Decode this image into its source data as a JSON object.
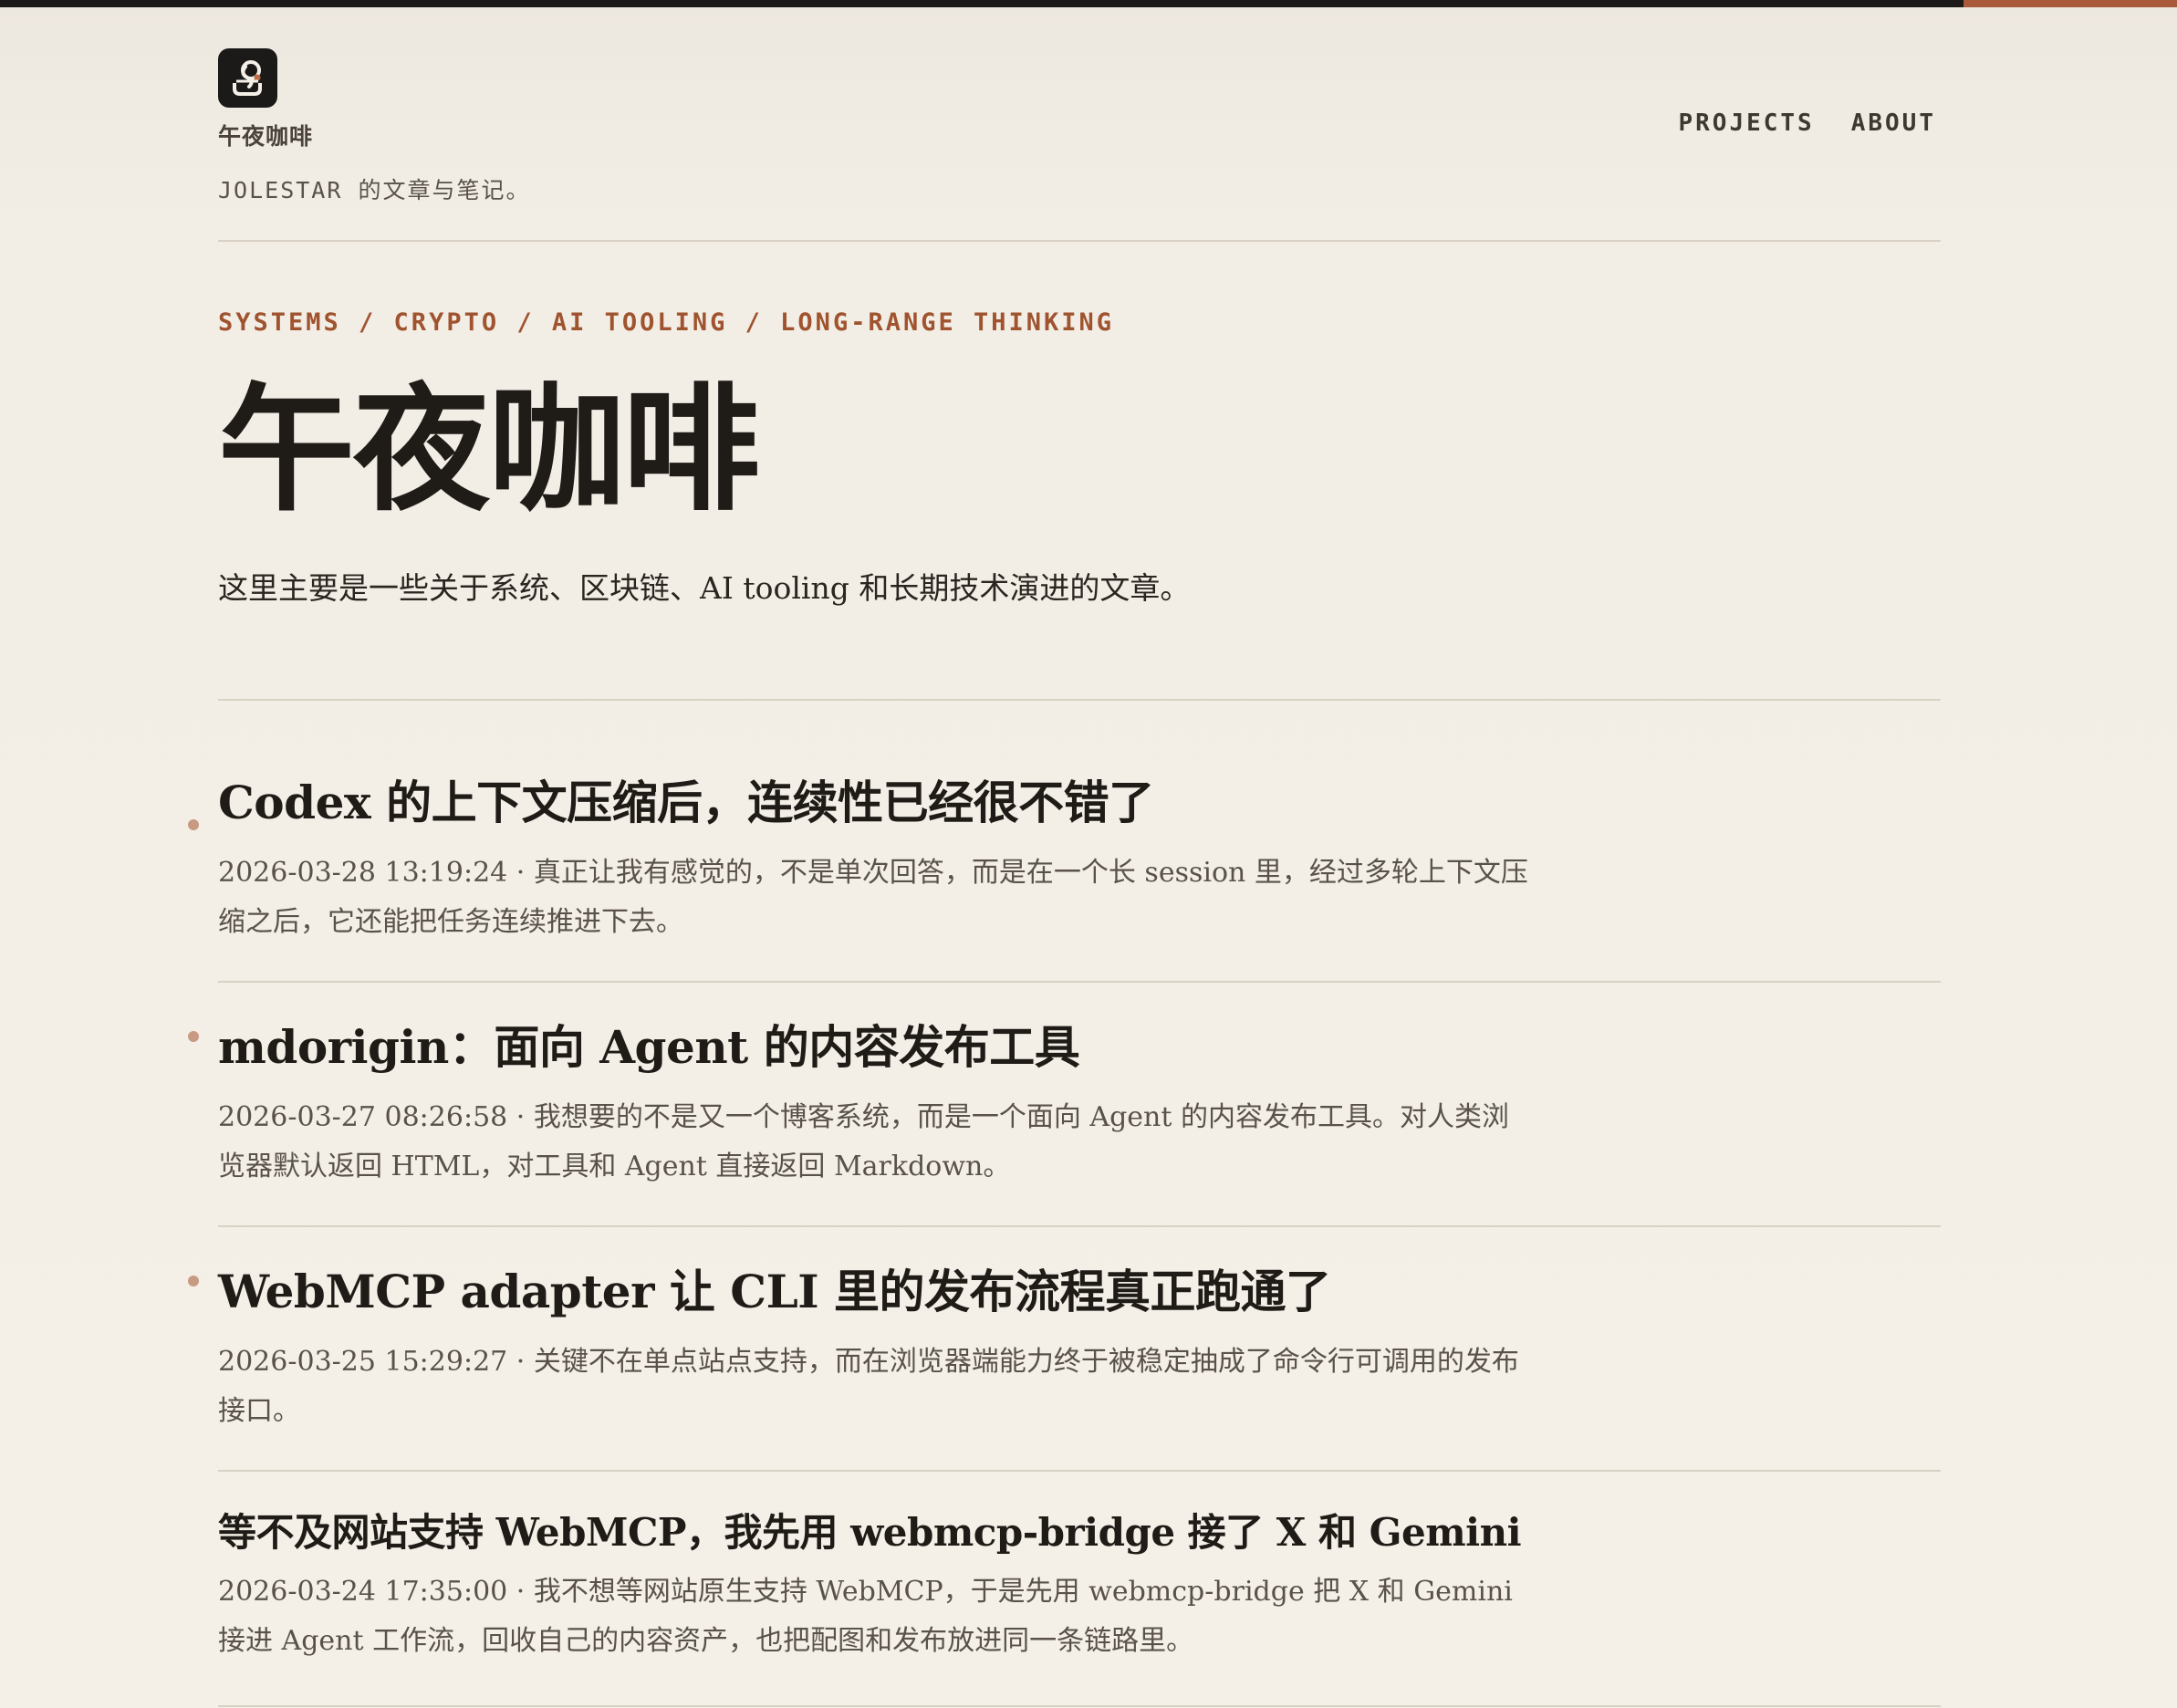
{
  "site": {
    "name": "午夜咖啡",
    "tagline": "JOLESTAR 的文章与笔记。"
  },
  "nav": {
    "items": [
      {
        "label": "PROJECTS"
      },
      {
        "label": "ABOUT"
      }
    ]
  },
  "hero": {
    "kicker": "SYSTEMS / CRYPTO / AI TOOLING / LONG-RANGE THINKING",
    "title": "午夜咖啡",
    "description": "这里主要是一些关于系统、区块链、AI tooling 和长期技术演进的文章。"
  },
  "posts": [
    {
      "title": "Codex 的上下文压缩后，连续性已经很不错了",
      "date": "2026-03-28 13:19:24",
      "separator": "·",
      "summary": "真正让我有感觉的，不是单次回答，而是在一个长 session 里，经过多轮上下文压缩之后，它还能把任务连续推进下去。"
    },
    {
      "title": "mdorigin：面向 Agent 的内容发布工具",
      "date": "2026-03-27 08:26:58",
      "separator": "·",
      "summary": "我想要的不是又一个博客系统，而是一个面向 Agent 的内容发布工具。对人类浏览器默认返回 HTML，对工具和 Agent 直接返回 Markdown。"
    },
    {
      "title": "WebMCP adapter 让 CLI 里的发布流程真正跑通了",
      "date": "2026-03-25 15:29:27",
      "separator": "·",
      "summary": "关键不在单点站点支持，而在浏览器端能力终于被稳定抽成了命令行可调用的发布接口。"
    },
    {
      "title": "等不及网站支持 WebMCP，我先用 webmcp-bridge 接了 X 和 Gemini",
      "date": "2026-03-24 17:35:00",
      "separator": "·",
      "summary": "我不想等网站原生支持 WebMCP，于是先用 webmcp-bridge 把 X 和 Gemini 接进 Agent 工作流，回收自己的内容资产，也把配图和发布放进同一条链路里。"
    }
  ],
  "colors": {
    "accent": "#a0532f",
    "background": "#f2eee6",
    "text": "#1f1b17",
    "muted": "#5a524a",
    "rule": "#d9d1c4",
    "dot": "#c89a82"
  }
}
